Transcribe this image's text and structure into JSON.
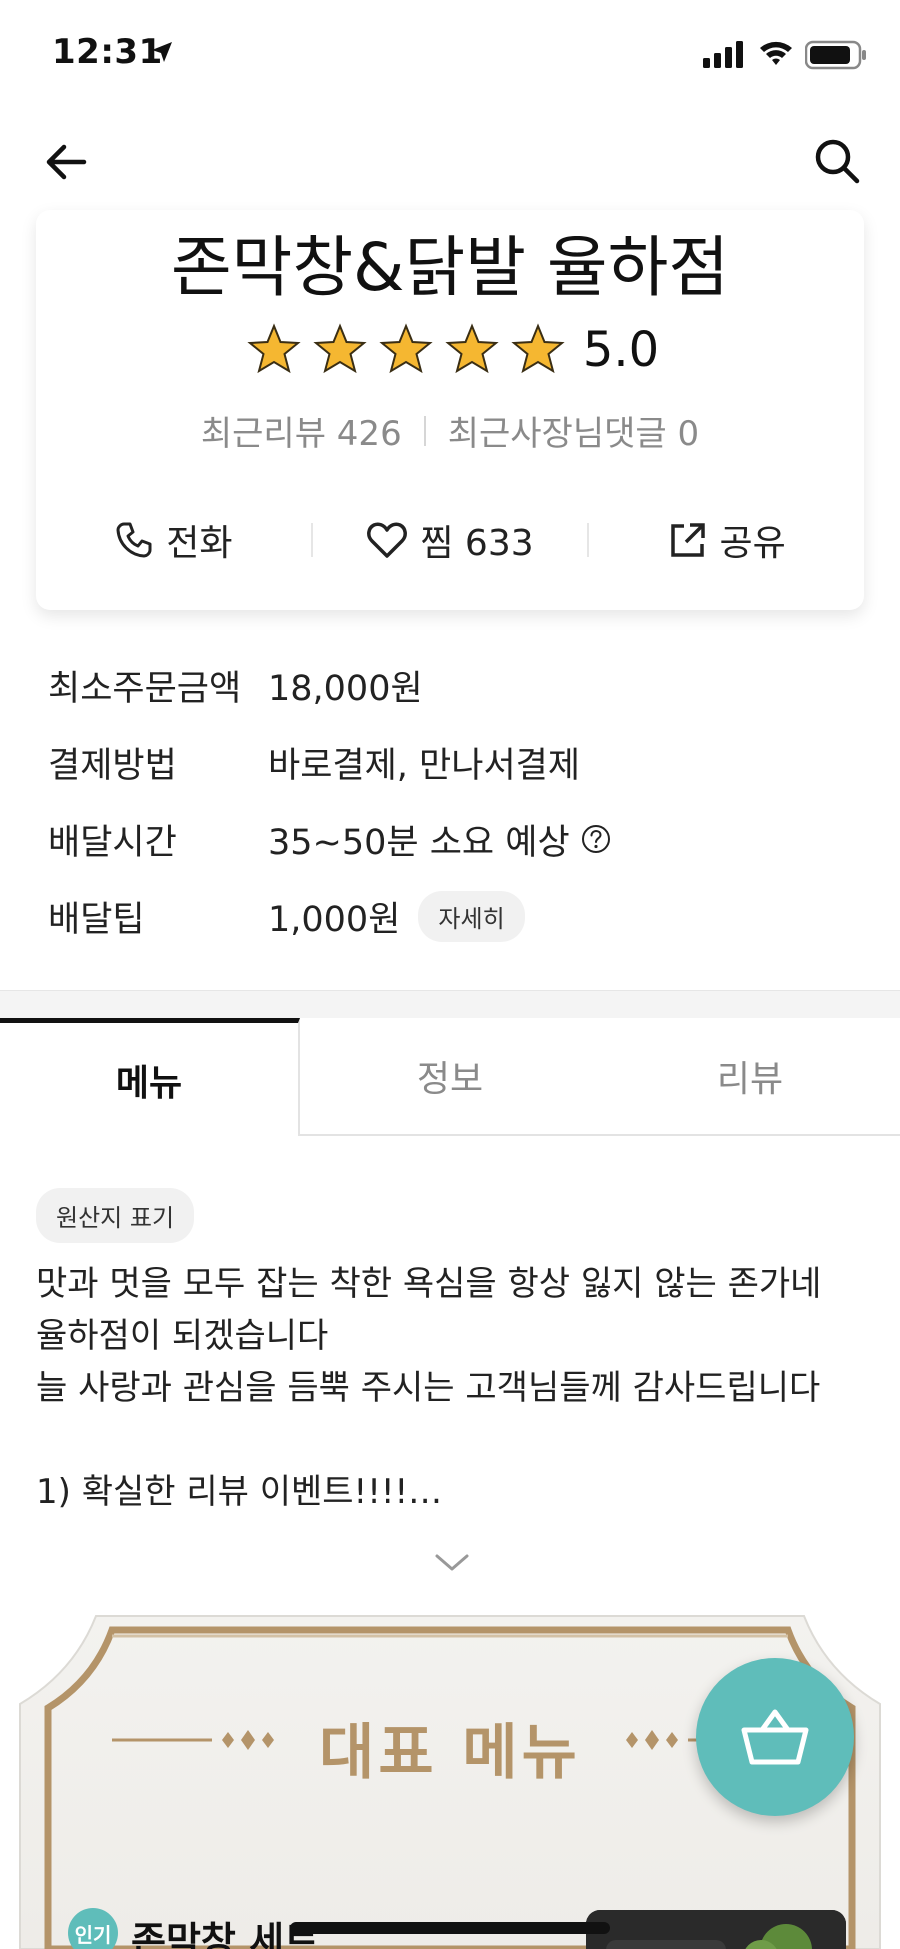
{
  "status_bar": {
    "time": "12:31",
    "icons": [
      "location-arrow-icon",
      "signal-icon",
      "wifi-icon",
      "battery-icon"
    ]
  },
  "nav": {
    "back_icon": "arrow-left-icon",
    "search_icon": "search-icon"
  },
  "store": {
    "name": "존막창&닭발 율하점",
    "rating": "5.0",
    "stars": 5,
    "recent_reviews_label": "최근리뷰 426",
    "recent_owner_comments_label": "최근사장님댓글 0",
    "actions": {
      "call": "전화",
      "favorite": "찜 633",
      "share": "공유"
    }
  },
  "info": {
    "min_order": {
      "label": "최소주문금액",
      "value": "18,000원"
    },
    "payment": {
      "label": "결제방법",
      "value": "바로결제, 만나서결제"
    },
    "delivery_time": {
      "label": "배달시간",
      "value": "35~50분 소요 예상"
    },
    "delivery_tip": {
      "label": "배달팁",
      "value": "1,000원",
      "detail_button": "자세히"
    }
  },
  "tabs": [
    {
      "label": "메뉴",
      "active": true
    },
    {
      "label": "정보",
      "active": false
    },
    {
      "label": "리뷰",
      "active": false
    }
  ],
  "notice": {
    "origin_chip": "원산지 표기",
    "lines": [
      "맛과 멋을 모두 잡는 착한 욕심을 항상 잃지 않는 존가네",
      "율하점이 되겠습니다",
      "늘 사랑과 관심을 듬뿍 주시는 고객님들께 감사드립니다",
      "",
      "1) 확실한 리뷰 이벤트!!!!…"
    ]
  },
  "featured": {
    "title": "대표 메뉴",
    "badge": "인기",
    "item_name": "존막창 세트"
  },
  "colors": {
    "accent": "#5fbdba",
    "gold": "#b49469",
    "star": "#f5b731"
  }
}
